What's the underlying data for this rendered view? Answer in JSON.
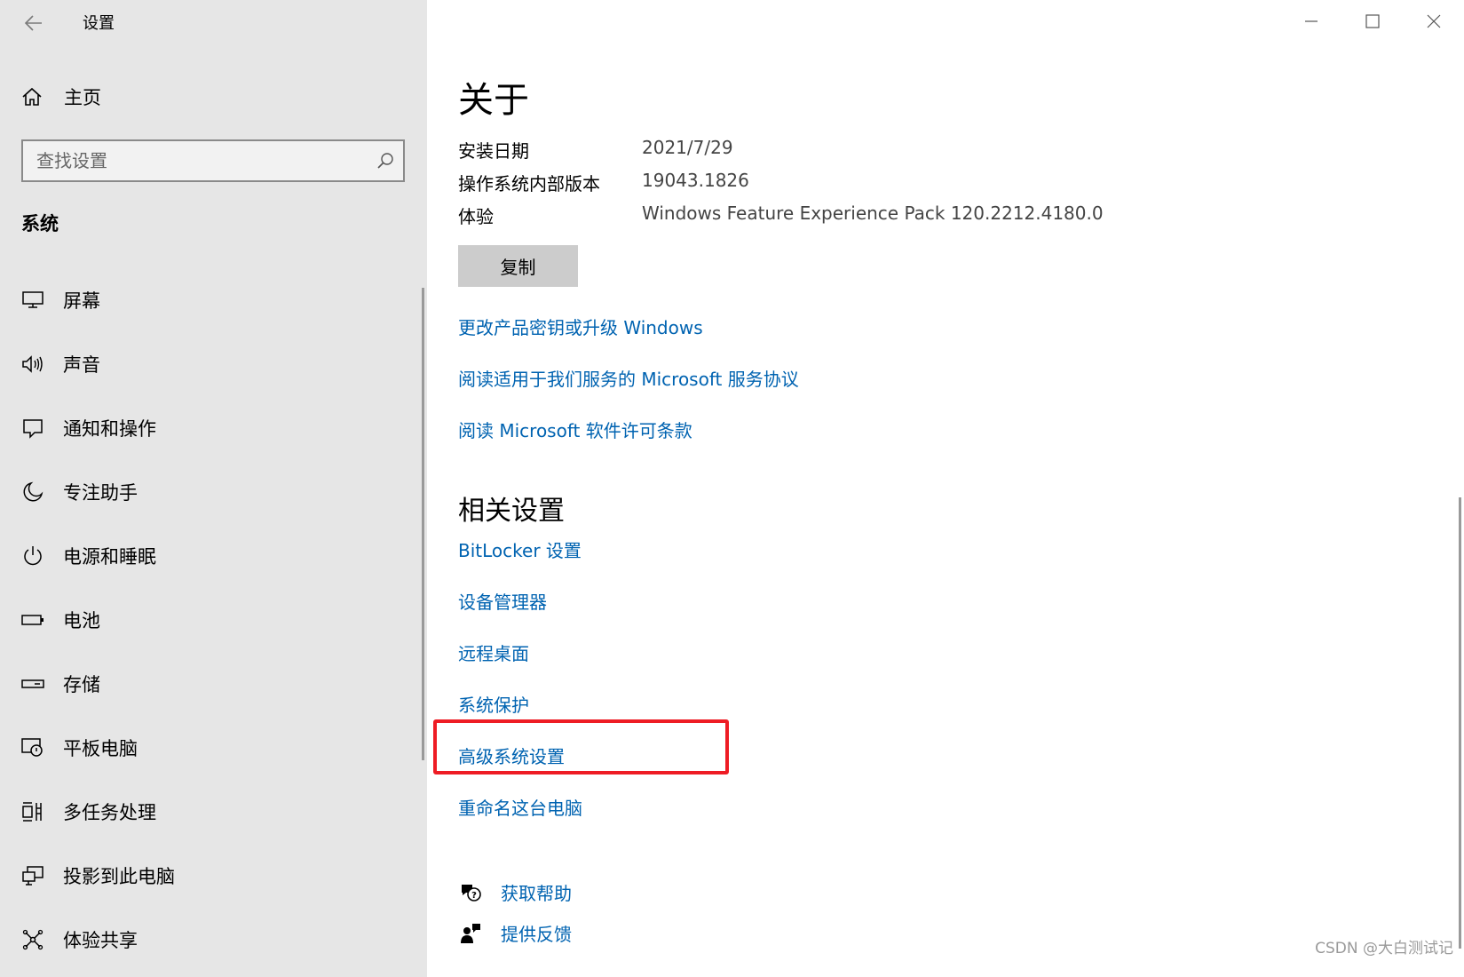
{
  "window": {
    "title": "设置",
    "controls": {
      "minimize": "minimize-icon",
      "maximize": "maximize-icon",
      "close": "close-icon"
    }
  },
  "sidebar": {
    "home_label": "主页",
    "search_placeholder": "查找设置",
    "section_heading": "系统",
    "items": [
      {
        "label": "屏幕",
        "icon": "monitor-icon"
      },
      {
        "label": "声音",
        "icon": "speaker-icon"
      },
      {
        "label": "通知和操作",
        "icon": "notification-icon"
      },
      {
        "label": "专注助手",
        "icon": "moon-icon"
      },
      {
        "label": "电源和睡眠",
        "icon": "power-icon"
      },
      {
        "label": "电池",
        "icon": "battery-icon"
      },
      {
        "label": "存储",
        "icon": "storage-icon"
      },
      {
        "label": "平板电脑",
        "icon": "tablet-icon"
      },
      {
        "label": "多任务处理",
        "icon": "multitask-icon"
      },
      {
        "label": "投影到此电脑",
        "icon": "project-icon"
      },
      {
        "label": "体验共享",
        "icon": "share-icon"
      }
    ]
  },
  "main": {
    "title": "关于",
    "specs": [
      {
        "key": "安装日期",
        "value": "2021/7/29"
      },
      {
        "key": "操作系统内部版本",
        "value": "19043.1826"
      },
      {
        "key": "体验",
        "value": "Windows Feature Experience Pack 120.2212.4180.0"
      }
    ],
    "copy_button": "复制",
    "links": [
      "更改产品密钥或升级 Windows",
      "阅读适用于我们服务的 Microsoft 服务协议",
      "阅读 Microsoft 软件许可条款"
    ],
    "related_title": "相关设置",
    "related_links": [
      "BitLocker 设置",
      "设备管理器",
      "远程桌面",
      "系统保护",
      "高级系统设置",
      "重命名这台电脑"
    ],
    "highlighted_link": "高级系统设置",
    "highlight_color": "#ee1c24",
    "link_color": "#0063b1",
    "help": [
      {
        "label": "获取帮助",
        "icon": "help-chat-icon"
      },
      {
        "label": "提供反馈",
        "icon": "feedback-icon"
      }
    ]
  },
  "watermark": "CSDN @大白测试记"
}
